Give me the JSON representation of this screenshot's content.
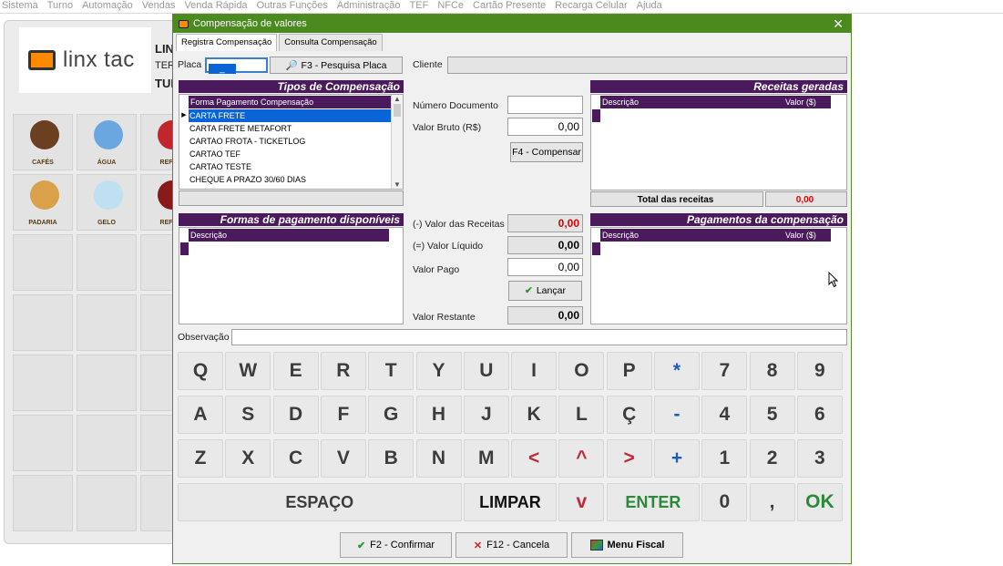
{
  "menu": [
    "Sistema",
    "Turno",
    "Automação",
    "Vendas",
    "Venda Rápida",
    "Outras Funções",
    "Administração",
    "TEF",
    "NFCe",
    "Cartão Presente",
    "Recarga Celular",
    "Ajuda"
  ],
  "background": {
    "logo_text": "linx tac",
    "side_text": [
      "LIN",
      "TER",
      "TUI"
    ],
    "products": [
      {
        "label": "CAFÉS",
        "icon": "coffee-icon",
        "color": "#6b3f1f"
      },
      {
        "label": "ÁGUA",
        "icon": "water-bottles-icon",
        "color": "#6aa7e0"
      },
      {
        "label": "REFRI.",
        "icon": "soda-cans-icon",
        "color": "#c0272d"
      },
      {
        "label": "PADARIA",
        "icon": "bread-icon",
        "color": "#d9a24a"
      },
      {
        "label": "GELO",
        "icon": "ice-icon",
        "color": "#bfe0f0"
      },
      {
        "label": "REFRI.",
        "icon": "soda-bottles-icon",
        "color": "#8a1a1a"
      }
    ]
  },
  "dialog": {
    "title": "Compensação de valores",
    "tabs": [
      "Registra Compensação",
      "Consulta Compensação"
    ],
    "placa_label": "Placa",
    "placa_value": "_",
    "pesquisa_button": "F3 - Pesquisa Placa",
    "cliente_label": "Cliente",
    "tipos_header": "Tipos de Compensação",
    "tipos_column": "Forma Pagamento Compensação",
    "tipos_items": [
      "CARTA FRETE",
      "CARTA FRETE METAFORT",
      "CARTAO FROTA - TICKETLOG",
      "CARTAO TEF",
      "CARTAO TESTE",
      "CHEQUE A PRAZO 30/60 DIAS"
    ],
    "numero_doc_label": "Número Documento",
    "valor_bruto_label": "Valor Bruto (R$)",
    "valor_bruto": "0,00",
    "compensar_button": "F4 - Compensar",
    "receitas_header": "Receitas geradas",
    "receitas_col_desc": "Descrição",
    "receitas_col_valor": "Valor ($)",
    "total_receitas_label": "Total das receitas",
    "total_receitas_value": "0,00",
    "formas_header": "Formas de pagamento disponíveis",
    "formas_col_desc": "Descrição",
    "valor_receitas_label": "(-) Valor das Receitas",
    "valor_receitas": "0,00",
    "valor_liquido_label": "(=) Valor Líquido",
    "valor_liquido": "0,00",
    "valor_pago_label": "Valor Pago",
    "valor_pago": "0,00",
    "lancar_button": "Lançar",
    "valor_restante_label": "Valor Restante",
    "valor_restante": "0,00",
    "pagamentos_header": "Pagamentos da compensação",
    "pagamentos_col_desc": "Descrição",
    "pagamentos_col_valor": "Valor ($)",
    "observacao_label": "Observação",
    "keyboard": {
      "row1": [
        "Q",
        "W",
        "E",
        "R",
        "T",
        "Y",
        "U",
        "I",
        "O",
        "P",
        "*",
        "7",
        "8",
        "9"
      ],
      "row2": [
        "A",
        "S",
        "D",
        "F",
        "G",
        "H",
        "J",
        "K",
        "L",
        "Ç",
        "-",
        "4",
        "5",
        "6"
      ],
      "row3": [
        "Z",
        "X",
        "C",
        "V",
        "B",
        "N",
        "M",
        "<",
        "^",
        ">",
        "+",
        "1",
        "2",
        "3"
      ],
      "space": "ESPAÇO",
      "clear": "LIMPAR",
      "down": "v",
      "enter": "ENTER",
      "zero": "0",
      "comma": ",",
      "ok": "OK"
    },
    "confirmar_button": "F2 - Confirmar",
    "cancela_button": "F12 - Cancela",
    "menu_fiscal_button": "Menu Fiscal"
  }
}
